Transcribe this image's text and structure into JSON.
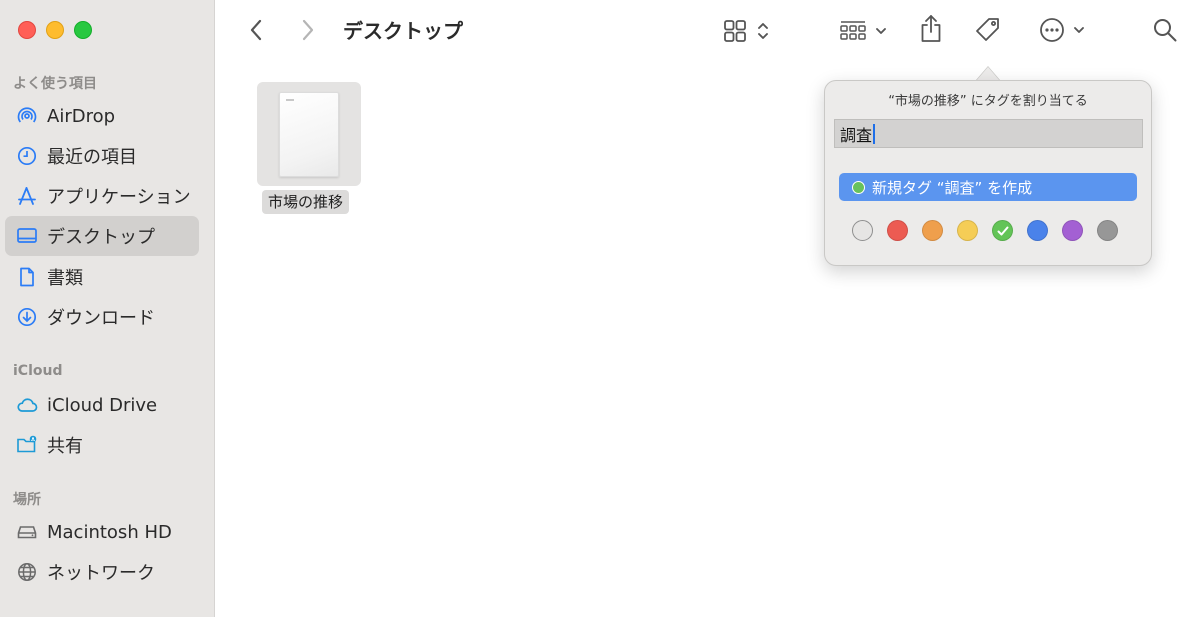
{
  "sidebar": {
    "sections": [
      {
        "title": "よく使う項目",
        "items": [
          "AirDrop",
          "最近の項目",
          "アプリケーション",
          "デスクトップ",
          "書類",
          "ダウンロード"
        ]
      },
      {
        "title": "iCloud",
        "items": [
          "iCloud Drive",
          "共有"
        ]
      },
      {
        "title": "場所",
        "items": [
          "Macintosh HD",
          "ネットワーク"
        ]
      }
    ],
    "selected": "デスクトップ"
  },
  "toolbar": {
    "title": "デスクトップ"
  },
  "content": {
    "file_name": "市場の推移"
  },
  "tag_popover": {
    "title": "“市場の推移” にタグを割り当てる",
    "input_value": "調査",
    "option_label": "新規タグ “調査” を作成",
    "colors": [
      {
        "name": "none",
        "hex": "#e6e5e4"
      },
      {
        "name": "red",
        "hex": "#ec5b52"
      },
      {
        "name": "orange",
        "hex": "#ef9f4c"
      },
      {
        "name": "yellow",
        "hex": "#f5cd56"
      },
      {
        "name": "green",
        "hex": "#63c457",
        "checked": true
      },
      {
        "name": "blue",
        "hex": "#4a82ea"
      },
      {
        "name": "purple",
        "hex": "#a360d3"
      },
      {
        "name": "gray",
        "hex": "#979797"
      }
    ]
  }
}
